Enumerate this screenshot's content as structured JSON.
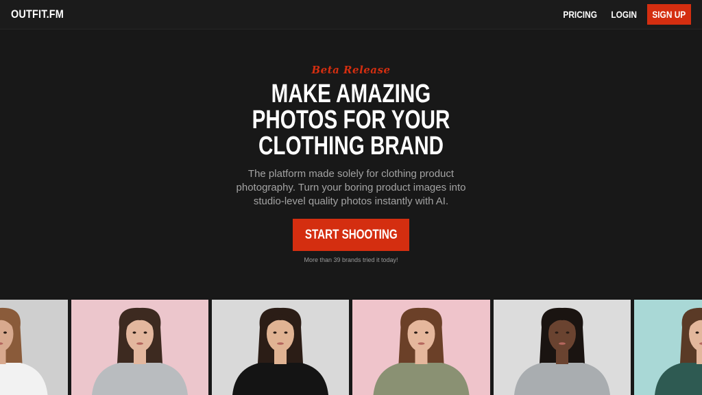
{
  "header": {
    "logo": "OUTFIT.FM",
    "nav": {
      "pricing": "PRICING",
      "login": "LOGIN",
      "signup": "SIGN UP"
    }
  },
  "hero": {
    "tag": "Beta Release",
    "headline": [
      "MAKE AMAZING",
      "PHOTOS FOR YOUR",
      "CLOTHING BRAND"
    ],
    "subtext": "The platform made solely for clothing product photography. Turn your boring product images into studio-level quality photos instantly with AI.",
    "cta": "START SHOOTING",
    "note": "More than 39 brands tried it today!"
  },
  "colors": {
    "accent": "#d42e10",
    "background": "#181818",
    "muted_text": "#a3a3a3"
  },
  "gallery": [
    {
      "name": "model-photo-1",
      "bg": "#cfcfcf",
      "skin": "#d8a98e",
      "hair": "#8a5b3a",
      "top": "#f2f2f2"
    },
    {
      "name": "model-photo-2",
      "bg": "#ecc6cc",
      "skin": "#e3b79e",
      "hair": "#3d2a20",
      "top": "#b9bcbf"
    },
    {
      "name": "model-photo-3",
      "bg": "#d9d9d9",
      "skin": "#e0b393",
      "hair": "#2b1d16",
      "top": "#141414"
    },
    {
      "name": "model-photo-4",
      "bg": "#efc4cb",
      "skin": "#e5b79c",
      "hair": "#6b4028",
      "top": "#8a9173"
    },
    {
      "name": "model-photo-5",
      "bg": "#dcdcdc",
      "skin": "#6a4330",
      "hair": "#1a1411",
      "top": "#a9adb0"
    },
    {
      "name": "model-photo-6",
      "bg": "#a9d8d6",
      "skin": "#e3b79c",
      "hair": "#5a3a26",
      "top": "#2e5a52"
    }
  ]
}
